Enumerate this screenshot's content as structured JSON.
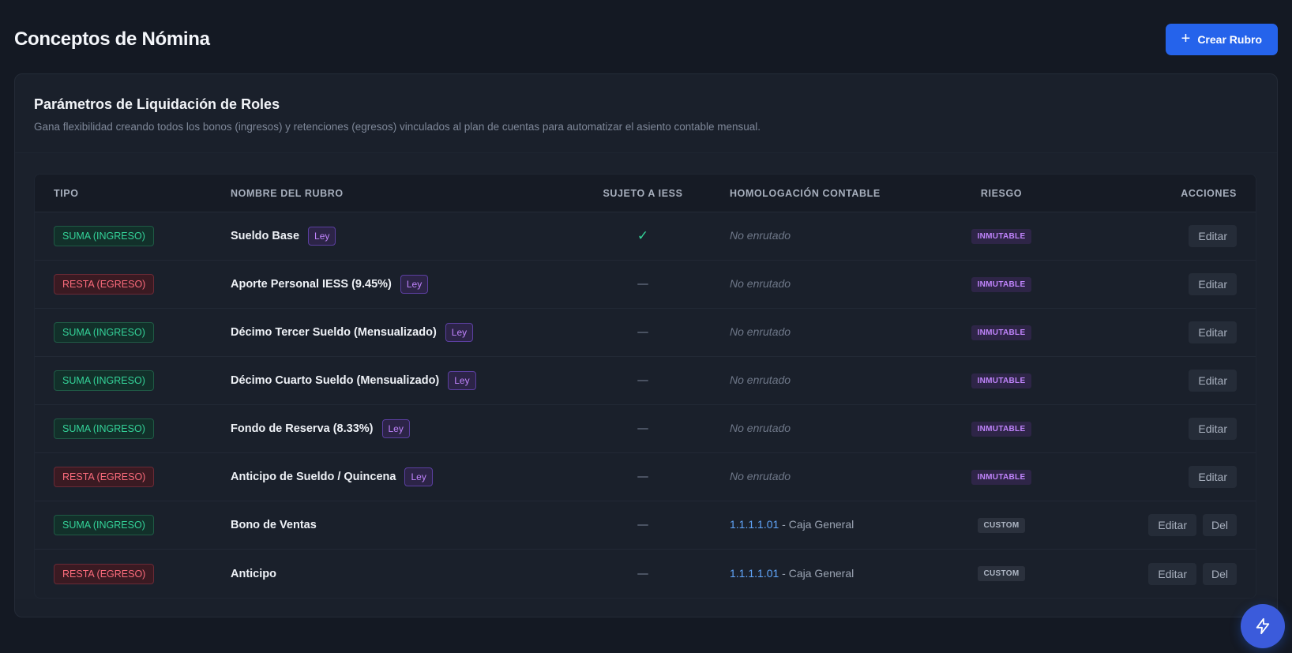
{
  "header": {
    "title": "Conceptos de Nómina",
    "create_label": "Crear Rubro"
  },
  "card": {
    "title": "Parámetros de Liquidación de Roles",
    "subtitle": "Gana flexibilidad creando todos los bonos (ingresos) y retenciones (egresos) vinculados al plan de cuentas para automatizar el asiento contable mensual."
  },
  "table": {
    "columns": {
      "tipo": "TIPO",
      "nombre": "NOMBRE DEL RUBRO",
      "iess": "SUJETO A IESS",
      "homologacion": "HOMOLOGACIÓN CONTABLE",
      "riesgo": "RIESGO",
      "acciones": "ACCIONES"
    },
    "rows": [
      {
        "tipo": "SUMA (INGRESO)",
        "tipo_kind": "suma",
        "nombre": "Sueldo Base",
        "ley": "Ley",
        "iess": true,
        "homologacion": "No enrutado",
        "riesgo": "INMUTABLE",
        "riesgo_kind": "inmutable",
        "editar": "Editar"
      },
      {
        "tipo": "RESTA (EGRESO)",
        "tipo_kind": "resta",
        "nombre": "Aporte Personal IESS (9.45%)",
        "ley": "Ley",
        "iess": false,
        "homologacion": "No enrutado",
        "riesgo": "INMUTABLE",
        "riesgo_kind": "inmutable",
        "editar": "Editar"
      },
      {
        "tipo": "SUMA (INGRESO)",
        "tipo_kind": "suma",
        "nombre": "Décimo Tercer Sueldo (Mensualizado)",
        "ley": "Ley",
        "iess": false,
        "homologacion": "No enrutado",
        "riesgo": "INMUTABLE",
        "riesgo_kind": "inmutable",
        "editar": "Editar"
      },
      {
        "tipo": "SUMA (INGRESO)",
        "tipo_kind": "suma",
        "nombre": "Décimo Cuarto Sueldo (Mensualizado)",
        "ley": "Ley",
        "iess": false,
        "homologacion": "No enrutado",
        "riesgo": "INMUTABLE",
        "riesgo_kind": "inmutable",
        "editar": "Editar"
      },
      {
        "tipo": "SUMA (INGRESO)",
        "tipo_kind": "suma",
        "nombre": "Fondo de Reserva (8.33%)",
        "ley": "Ley",
        "iess": false,
        "homologacion": "No enrutado",
        "riesgo": "INMUTABLE",
        "riesgo_kind": "inmutable",
        "editar": "Editar"
      },
      {
        "tipo": "RESTA (EGRESO)",
        "tipo_kind": "resta",
        "nombre": "Anticipo de Sueldo / Quincena",
        "ley": "Ley",
        "iess": false,
        "homologacion": "No enrutado",
        "riesgo": "INMUTABLE",
        "riesgo_kind": "inmutable",
        "editar": "Editar"
      },
      {
        "tipo": "SUMA (INGRESO)",
        "tipo_kind": "suma",
        "nombre": "Bono de Ventas",
        "iess": false,
        "cuenta_codigo": "1.1.1.1.01",
        "cuenta_nombre": " - Caja General",
        "riesgo": "CUSTOM",
        "riesgo_kind": "custom",
        "editar": "Editar",
        "del": "Del"
      },
      {
        "tipo": "RESTA (EGRESO)",
        "tipo_kind": "resta",
        "nombre": "Anticipo",
        "iess": false,
        "cuenta_codigo": "1.1.1.1.01",
        "cuenta_nombre": " - Caja General",
        "riesgo": "CUSTOM",
        "riesgo_kind": "custom",
        "editar": "Editar",
        "del": "Del"
      }
    ]
  },
  "icons": {
    "create": "plus-icon",
    "fab": "lightning-icon",
    "iess_yes": "check-icon",
    "iess_no": "dash-icon"
  },
  "colors": {
    "accent": "#2563eb",
    "suma": "#34d399",
    "resta": "#fb6b7b",
    "ley": "#c084fc",
    "link": "#60a5fa"
  }
}
